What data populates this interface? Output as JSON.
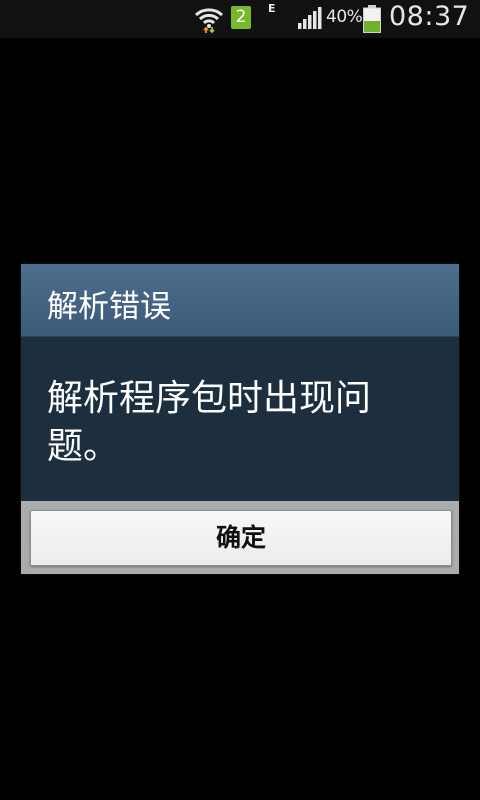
{
  "status_bar": {
    "sim_slot": "2",
    "network_type": "E",
    "battery_percent": "40%",
    "time": "08:37",
    "icons": [
      "wifi-icon",
      "signal-icon",
      "battery-icon"
    ],
    "colors": {
      "sim_badge": "#78b92a",
      "battery_fill": "#6fb22b"
    },
    "battery_level": 0.4
  },
  "dialog": {
    "title": "解析错误",
    "message": "解析程序包时出现问题。",
    "ok_button_label": "确定",
    "colors": {
      "header": "#456484",
      "body": "#1d2e3f",
      "footer": "#a9abad",
      "button": "#f2f2f2"
    }
  }
}
